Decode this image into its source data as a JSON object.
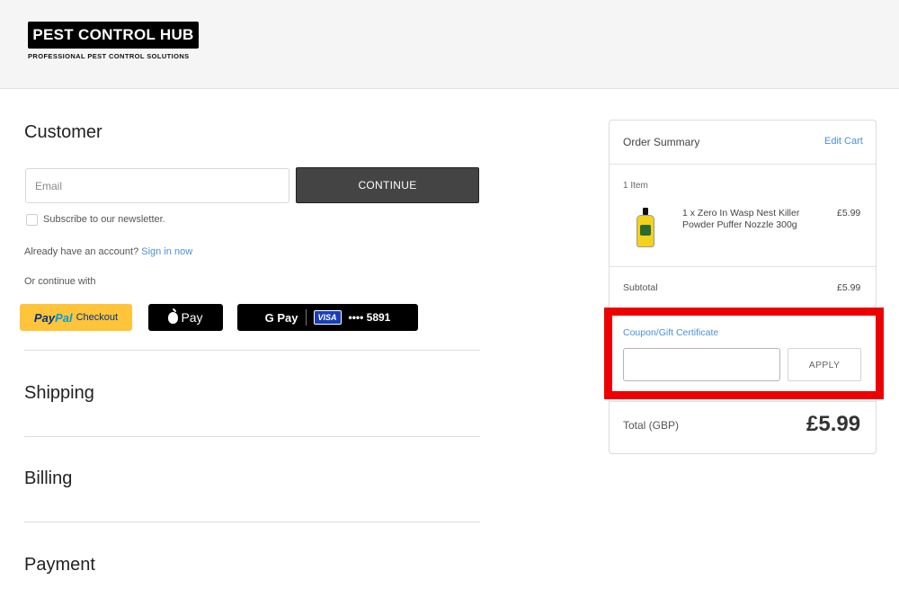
{
  "header": {
    "logo_title": "PEST CONTROL HUB",
    "logo_subtitle": "PROFESSIONAL PEST CONTROL SOLUTIONS"
  },
  "customer": {
    "title": "Customer",
    "email_placeholder": "Email",
    "email_value": "",
    "continue_label": "CONTINUE",
    "newsletter_label": "Subscribe to our newsletter.",
    "newsletter_checked": false,
    "account_prompt": "Already have an account?",
    "sign_in_label": "Sign in now",
    "or_continue": "Or continue with"
  },
  "payment_buttons": {
    "paypal_pay": "Pay",
    "paypal_pal": "Pal",
    "paypal_checkout": "Checkout",
    "apple_pay_label": "Pay",
    "google_pay_label": "G Pay",
    "card_brand": "VISA",
    "card_digits": "•••• 5891"
  },
  "sections": {
    "shipping": "Shipping",
    "billing": "Billing",
    "payment": "Payment"
  },
  "order_summary": {
    "title": "Order Summary",
    "edit_cart": "Edit Cart",
    "item_count": "1 Item",
    "items": [
      {
        "name": "1 x Zero In Wasp Nest Killer Powder Puffer Nozzle 300g",
        "price": "£5.99"
      }
    ],
    "subtotal_label": "Subtotal",
    "subtotal_value": "£5.99",
    "coupon_label": "Coupon/Gift Certificate",
    "coupon_value": "",
    "apply_label": "APPLY",
    "total_label": "Total (GBP)",
    "total_value": "£5.99"
  },
  "colors": {
    "link": "#4a90d9",
    "highlight": "#ee0000",
    "paypal_yellow": "#ffc439"
  }
}
